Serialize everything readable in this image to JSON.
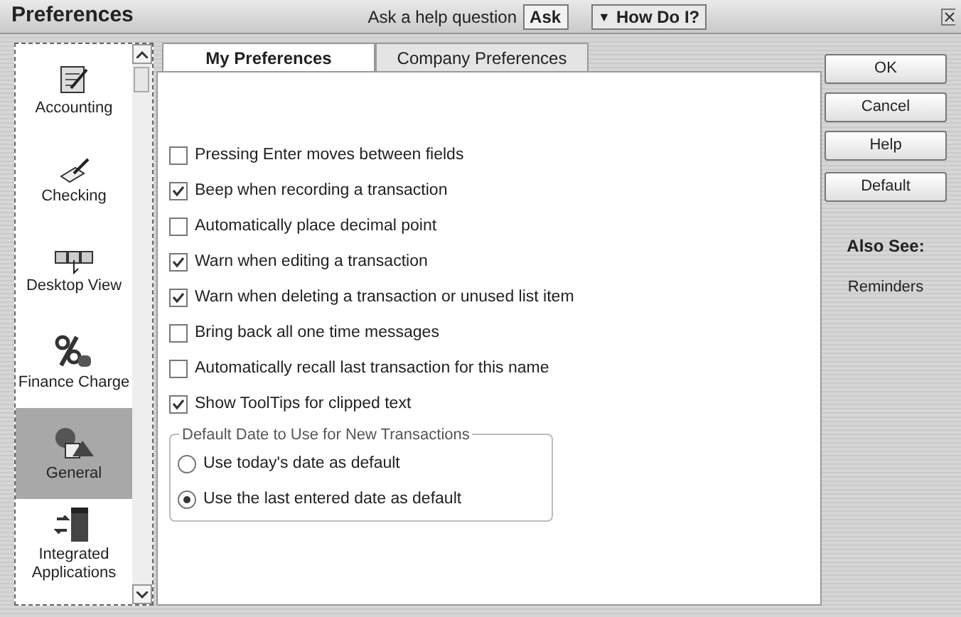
{
  "window": {
    "title": "Preferences"
  },
  "help": {
    "label": "Ask a help question",
    "ask_button": "Ask",
    "how_do_i": "How Do I?",
    "how_do_i_arrow": "▼"
  },
  "sidebar": {
    "items": [
      {
        "label": "Accounting",
        "kind": "accounting",
        "selected": false
      },
      {
        "label": "Checking",
        "kind": "checking",
        "selected": false
      },
      {
        "label": "Desktop View",
        "kind": "desktop",
        "selected": false
      },
      {
        "label": "Finance Charge",
        "kind": "finance",
        "selected": false
      },
      {
        "label": "General",
        "kind": "general",
        "selected": true
      },
      {
        "label": "Integrated Applications",
        "kind": "integrated",
        "selected": false
      }
    ]
  },
  "tabs": [
    {
      "label": "My Preferences",
      "selected": true
    },
    {
      "label": "Company Preferences",
      "selected": false
    }
  ],
  "options": [
    {
      "label": "Pressing Enter moves between fields",
      "checked": false
    },
    {
      "label": "Beep when recording a transaction",
      "checked": true
    },
    {
      "label": "Automatically place decimal point",
      "checked": false
    },
    {
      "label": "Warn when editing a transaction",
      "checked": true
    },
    {
      "label": "Warn when deleting a transaction or unused list item",
      "checked": true
    },
    {
      "label": "Bring back all one time messages",
      "checked": false
    },
    {
      "label": "Automatically recall last transaction for this name",
      "checked": false
    },
    {
      "label": "Show ToolTips for clipped text",
      "checked": true
    }
  ],
  "date_group": {
    "title": "Default Date to Use for New Transactions",
    "choices": [
      {
        "label": "Use today's date as default",
        "selected": false
      },
      {
        "label": "Use the last entered date as default",
        "selected": true
      }
    ]
  },
  "buttons": [
    "OK",
    "Cancel",
    "Help",
    "Default"
  ],
  "also_see": {
    "title": "Also See:",
    "links": [
      "Reminders"
    ]
  }
}
